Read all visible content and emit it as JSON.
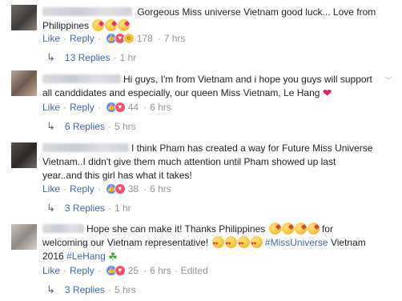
{
  "comments": [
    {
      "text": "Gorgeous Miss universe Vietnam good luck... Love from Philippines",
      "text_line1": "Gorgeous Miss universe Vietnam good luck... Love from",
      "text_line2": "Philippines",
      "like_label": "Like",
      "reply_label": "Reply",
      "reaction_count": "178",
      "time": "7 hrs",
      "replies_label": "13 Replies",
      "replies_time": "1 hr"
    },
    {
      "text_line1": "Hi guys, I'm from Vietnam and i hope you guys will support",
      "text_line2": "all canddidates and especially, our queen Miss Vietnam, Le Hang",
      "like_label": "Like",
      "reply_label": "Reply",
      "reaction_count": "44",
      "time": "6 hrs",
      "replies_label": "6 Replies",
      "replies_time": "5 hrs"
    },
    {
      "text_line1": "I think Pham has created a way for Future Miss Universe",
      "text_line2": "Vietnam..I didn't give them much attention until Pham showed up last",
      "text_line3": "year..and this girl has what it takes!",
      "like_label": "Like",
      "reply_label": "Reply",
      "reaction_count": "38",
      "time": "6 hrs",
      "replies_label": "3 Replies",
      "replies_time": "1 hr"
    },
    {
      "text_line1a": "Hope she can make it! Thanks Philippines",
      "text_line1b": "for",
      "text_line2a": "welcoming our Vietnam representative!",
      "text_line2_hashtag": "#MissUniverse",
      "text_line2b": "Vietnam",
      "text_line3a": "2016",
      "text_line3_hashtag": "#LeHang",
      "like_label": "Like",
      "reply_label": "Reply",
      "reaction_count": "25",
      "time": "6 hrs",
      "edited_label": "Edited",
      "replies_label": "3 Replies",
      "replies_time": "5 hrs"
    }
  ],
  "colors": {
    "link": "#4267b2",
    "meta": "#90949c",
    "text": "#1d2129",
    "like_reaction": "#5890ff",
    "love_reaction": "#f25268",
    "wow_reaction": "#f7c23b"
  }
}
